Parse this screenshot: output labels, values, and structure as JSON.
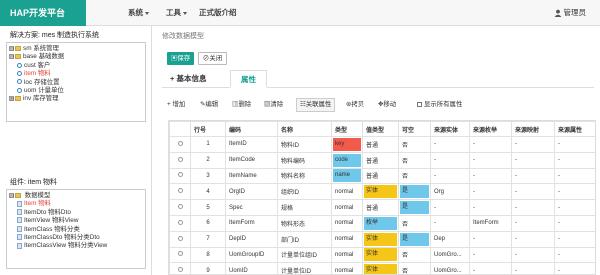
{
  "app": {
    "brand": "HAP开发平台"
  },
  "nav": {
    "menu_system": "系统",
    "menu_tools": "工具",
    "menu_intro": "正式版介绍",
    "user": "管理员"
  },
  "left": {
    "solution_label": "解决方案: mes 制造执行系统",
    "tree": [
      {
        "toggle": "⊟",
        "code": "sm",
        "name": "系统管理",
        "level": 0,
        "kind": "folder",
        "hl": false
      },
      {
        "toggle": "⊟",
        "code": "base",
        "name": "基础数据",
        "level": 0,
        "kind": "folder",
        "hl": false
      },
      {
        "toggle": "",
        "code": "cust",
        "name": "客户",
        "level": 1,
        "kind": "dot",
        "hl": false
      },
      {
        "toggle": "",
        "code": "item",
        "name": "物料",
        "level": 1,
        "kind": "dot",
        "hl": true
      },
      {
        "toggle": "",
        "code": "loc",
        "name": "存储位置",
        "level": 1,
        "kind": "dot",
        "hl": false
      },
      {
        "toggle": "",
        "code": "uom",
        "name": "计量单位",
        "level": 1,
        "kind": "dot",
        "hl": false
      },
      {
        "toggle": "⊞",
        "code": "inv",
        "name": "库存管理",
        "level": 0,
        "kind": "folder",
        "hl": false
      }
    ],
    "component_label": "组件: item 物料",
    "tree2": [
      {
        "toggle": "⊟",
        "code": "",
        "name": "数据模型",
        "level": 0,
        "kind": "folder",
        "hl": false
      },
      {
        "toggle": "",
        "code": "Item",
        "name": "物料",
        "level": 1,
        "kind": "doc",
        "hl": true
      },
      {
        "toggle": "",
        "code": "ItemDto",
        "name": "物料Dto",
        "level": 1,
        "kind": "doc",
        "hl": false
      },
      {
        "toggle": "",
        "code": "ItemView",
        "name": "物料View",
        "level": 1,
        "kind": "doc",
        "hl": false
      },
      {
        "toggle": "",
        "code": "ItemClass",
        "name": "物料分类",
        "level": 1,
        "kind": "doc",
        "hl": false
      },
      {
        "toggle": "",
        "code": "ItemClassDto",
        "name": "物料分类Dto",
        "level": 1,
        "kind": "doc",
        "hl": false
      },
      {
        "toggle": "",
        "code": "ItemClassView",
        "name": "物料分类View",
        "level": 1,
        "kind": "doc",
        "hl": false
      }
    ]
  },
  "main": {
    "title": "修改数据模型",
    "save": "保存",
    "close": "关闭",
    "tab_basic": "+ 基本信息",
    "tab_attr": "属性",
    "toolbar": {
      "add": "+ 增加",
      "edit": "编辑",
      "del": "删除",
      "clear": "清除",
      "assoc": "关联属性",
      "copy": "拷贝",
      "move": "移动",
      "show_all": "显示所有属性"
    },
    "columns": [
      "",
      "行号",
      "编码",
      "名称",
      "类型",
      "值类型",
      "可空",
      "来源实体",
      "来源枚举",
      "来源映射",
      "来源属性"
    ],
    "rows": [
      {
        "n": "1",
        "code": "ItemID",
        "name": "物料ID",
        "type": "key",
        "vtype": "普通",
        "null": "否",
        "entity": "-",
        "enum": "-",
        "map": "-",
        "attr": "-"
      },
      {
        "n": "2",
        "code": "ItemCode",
        "name": "物料编码",
        "type": "code",
        "vtype": "普通",
        "null": "否",
        "entity": "-",
        "enum": "-",
        "map": "-",
        "attr": "-"
      },
      {
        "n": "3",
        "code": "ItemName",
        "name": "物料名称",
        "type": "name",
        "vtype": "普通",
        "null": "否",
        "entity": "-",
        "enum": "-",
        "map": "-",
        "attr": "-"
      },
      {
        "n": "4",
        "code": "OrgID",
        "name": "组织ID",
        "type": "normal",
        "vtype": "实体",
        "null": "是",
        "entity": "Org",
        "enum": "-",
        "map": "-",
        "attr": "-"
      },
      {
        "n": "5",
        "code": "Spec",
        "name": "规格",
        "type": "normal",
        "vtype": "普通",
        "null": "是",
        "entity": "-",
        "enum": "-",
        "map": "-",
        "attr": "-"
      },
      {
        "n": "6",
        "code": "ItemForm",
        "name": "物料形态",
        "type": "normal",
        "vtype": "枚举",
        "null": "否",
        "entity": "-",
        "enum": "ItemForm",
        "map": "-",
        "attr": "-"
      },
      {
        "n": "7",
        "code": "DepID",
        "name": "部门ID",
        "type": "normal",
        "vtype": "实体",
        "null": "是",
        "entity": "Dep",
        "enum": "-",
        "map": "-",
        "attr": "-"
      },
      {
        "n": "8",
        "code": "UomGroupID",
        "name": "计量单位组ID",
        "type": "normal",
        "vtype": "实体",
        "null": "否",
        "entity": "UomGro...",
        "enum": "-",
        "map": "-",
        "attr": "-"
      },
      {
        "n": "9",
        "code": "UomID",
        "name": "计量单位ID",
        "type": "normal",
        "vtype": "实体",
        "null": "否",
        "entity": "UomGro...",
        "enum": "-",
        "map": "-",
        "attr": "-"
      }
    ]
  },
  "colors": {
    "brand": "#1ba192",
    "type_key": "#f25a4b",
    "type_code_name": "#6fc7ea",
    "vtype_entity": "#f5c518",
    "vtype_enum": "#6fc7ea",
    "null_yes": "#6fc7ea"
  }
}
